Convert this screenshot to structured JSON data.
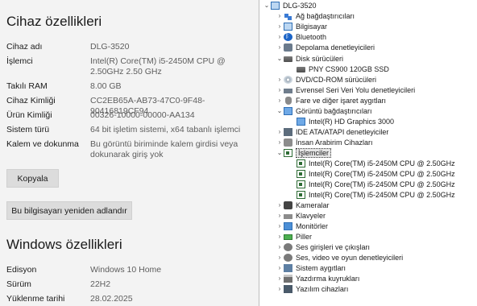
{
  "device_specs": {
    "title": "Cihaz özellikleri",
    "rows": [
      {
        "key": "Cihaz adı",
        "value": "DLG-3520"
      },
      {
        "key": "İşlemci",
        "value": "Intel(R) Core(TM) i5-2450M CPU @ 2.50GHz 2.50 GHz"
      },
      {
        "key": "Takılı RAM",
        "value": "8.00 GB"
      },
      {
        "key": "Cihaz Kimliği",
        "value": "CC2EB65A-AB73-47C0-9F48-90416819CF94"
      },
      {
        "key": "Ürün Kimliği",
        "value": "00326-10000-00000-AA134"
      },
      {
        "key": "Sistem türü",
        "value": "64 bit işletim sistemi, x64 tabanlı işlemci"
      },
      {
        "key": "Kalem ve dokunma",
        "value": "Bu görüntü biriminde kalem girdisi veya dokunarak giriş yok"
      }
    ],
    "copy_button": "Kopyala",
    "rename_button": "Bu bilgisayarı yeniden adlandır"
  },
  "windows_specs": {
    "title": "Windows özellikleri",
    "rows": [
      {
        "key": "Edisyon",
        "value": "Windows 10 Home"
      },
      {
        "key": "Sürüm",
        "value": "22H2"
      },
      {
        "key": "Yüklenme tarihi",
        "value": "28.02.2025"
      }
    ]
  },
  "device_manager": {
    "root": "DLG-3520",
    "items": [
      {
        "label": "Ağ bağdaştırıcıları",
        "icon": "network-icon"
      },
      {
        "label": "Bilgisayar",
        "icon": "computer-icon"
      },
      {
        "label": "Bluetooth",
        "icon": "bluetooth-icon"
      },
      {
        "label": "Depolama denetleyicileri",
        "icon": "storage-controller-icon"
      },
      {
        "label": "Disk sürücüleri",
        "icon": "disk-drive-icon",
        "expanded": true,
        "children": [
          "PNY CS900 120GB SSD"
        ]
      },
      {
        "label": "DVD/CD-ROM sürücüleri",
        "icon": "dvd-icon"
      },
      {
        "label": "Evrensel Seri Veri Yolu denetleyicileri",
        "icon": "usb-icon"
      },
      {
        "label": "Fare ve diğer işaret aygıtları",
        "icon": "mouse-icon"
      },
      {
        "label": "Görüntü bağdaştırıcıları",
        "icon": "display-adapter-icon",
        "expanded": true,
        "children": [
          "Intel(R) HD Graphics 3000"
        ]
      },
      {
        "label": "IDE ATA/ATAPI denetleyiciler",
        "icon": "ide-icon"
      },
      {
        "label": "İnsan Arabirim Cihazları",
        "icon": "hid-icon"
      },
      {
        "label": "İşlemciler",
        "icon": "processor-icon",
        "expanded": true,
        "selected": true,
        "children": [
          "Intel(R) Core(TM) i5-2450M CPU @ 2.50GHz",
          "Intel(R) Core(TM) i5-2450M CPU @ 2.50GHz",
          "Intel(R) Core(TM) i5-2450M CPU @ 2.50GHz",
          "Intel(R) Core(TM) i5-2450M CPU @ 2.50GHz"
        ]
      },
      {
        "label": "Kameralar",
        "icon": "camera-icon"
      },
      {
        "label": "Klavyeler",
        "icon": "keyboard-icon"
      },
      {
        "label": "Monitörler",
        "icon": "monitor-icon"
      },
      {
        "label": "Piller",
        "icon": "battery-icon"
      },
      {
        "label": "Ses girişleri ve çıkışları",
        "icon": "audio-io-icon"
      },
      {
        "label": "Ses, video ve oyun denetleyicileri",
        "icon": "sound-controller-icon"
      },
      {
        "label": "Sistem aygıtları",
        "icon": "system-devices-icon"
      },
      {
        "label": "Yazdırma kuyrukları",
        "icon": "print-queue-icon"
      },
      {
        "label": "Yazılım cihazları",
        "icon": "software-device-icon"
      }
    ]
  }
}
